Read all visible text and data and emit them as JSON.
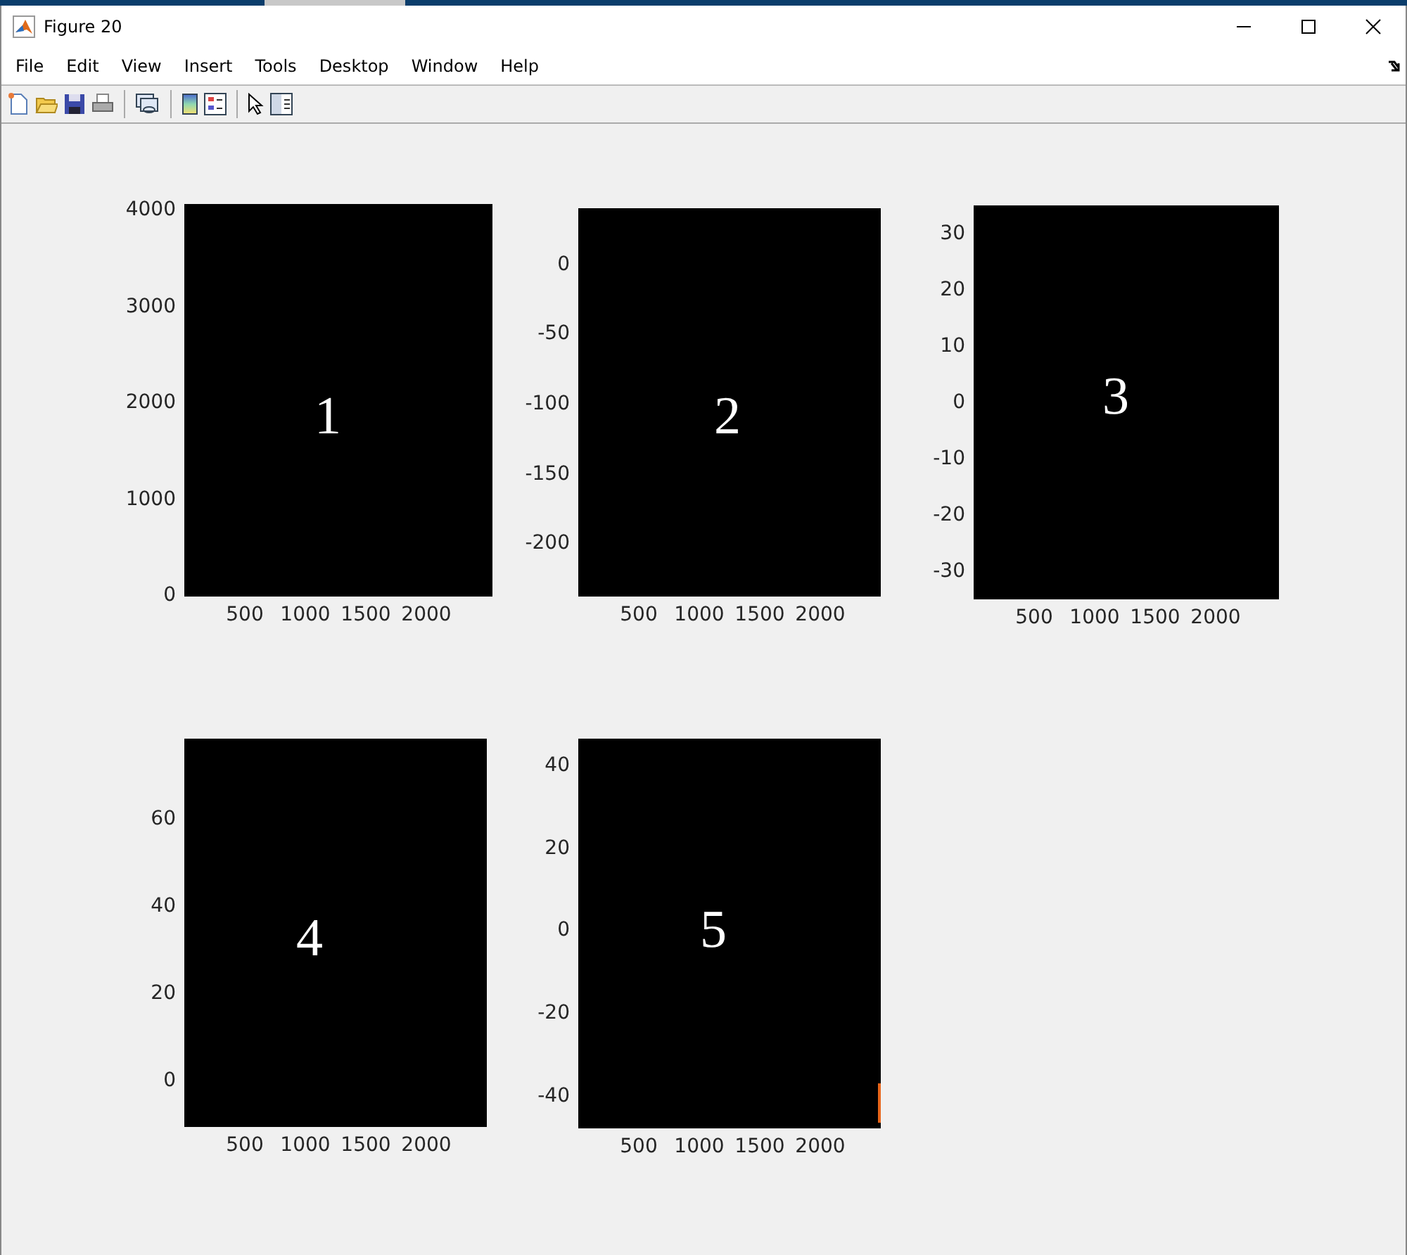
{
  "window": {
    "title": "Figure 20"
  },
  "menu": [
    "File",
    "Edit",
    "View",
    "Insert",
    "Tools",
    "Desktop",
    "Window",
    "Help"
  ],
  "axes": [
    {
      "label": "1",
      "xticks": [
        "500",
        "1000",
        "1500",
        "2000"
      ],
      "yticks": [
        "4000",
        "3000",
        "2000",
        "1000",
        "0"
      ]
    },
    {
      "label": "2",
      "xticks": [
        "500",
        "1000",
        "1500",
        "2000"
      ],
      "yticks": [
        "0",
        "-50",
        "-100",
        "-150",
        "-200"
      ]
    },
    {
      "label": "3",
      "xticks": [
        "500",
        "1000",
        "1500",
        "2000"
      ],
      "yticks": [
        "30",
        "20",
        "10",
        "0",
        "-10",
        "-20",
        "-30"
      ]
    },
    {
      "label": "4",
      "xticks": [
        "500",
        "1000",
        "1500",
        "2000"
      ],
      "yticks": [
        "60",
        "40",
        "20",
        "0"
      ]
    },
    {
      "label": "5",
      "xticks": [
        "500",
        "1000",
        "1500",
        "2000"
      ],
      "yticks": [
        "40",
        "20",
        "0",
        "-20",
        "-40"
      ]
    }
  ]
}
